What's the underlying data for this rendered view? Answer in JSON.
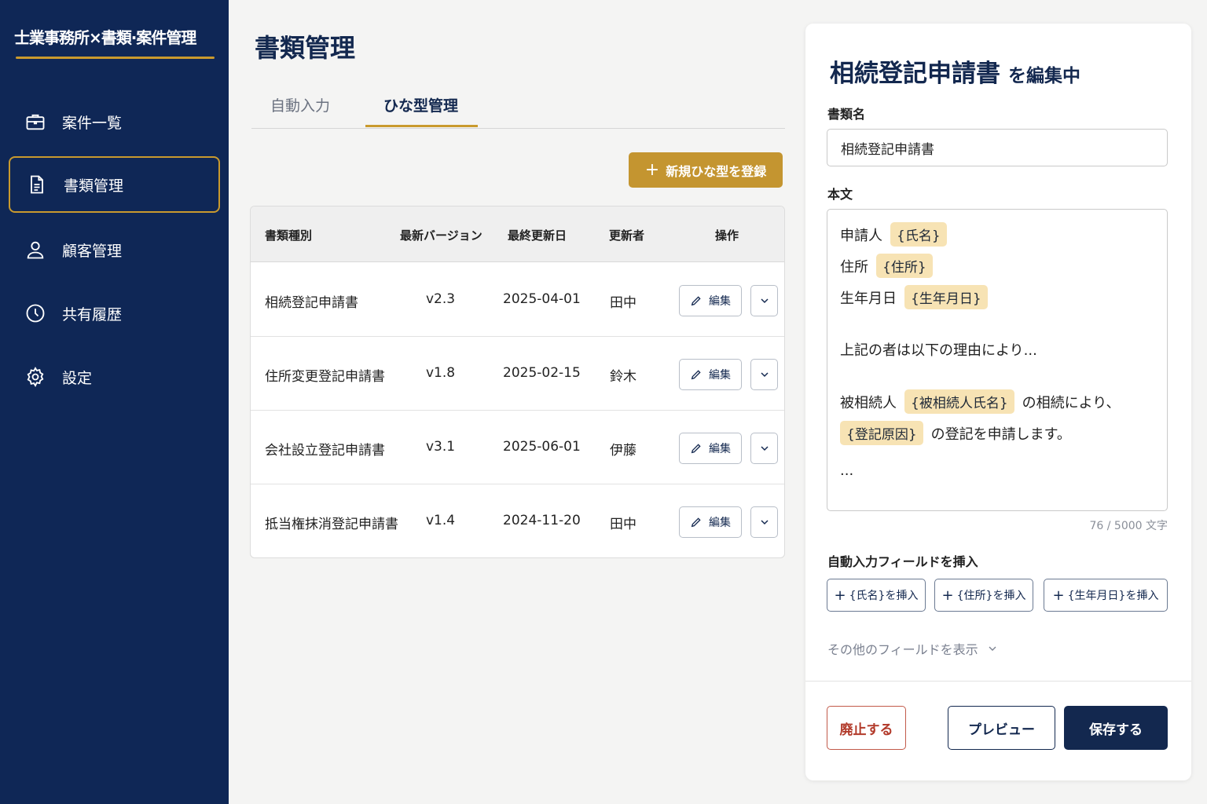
{
  "app": {
    "title": "士業事務所×書類·案件管理"
  },
  "sidebar": {
    "items": [
      {
        "label": "案件一覧",
        "icon": "briefcase-icon"
      },
      {
        "label": "書類管理",
        "icon": "document-icon"
      },
      {
        "label": "顧客管理",
        "icon": "user-icon"
      },
      {
        "label": "共有履歴",
        "icon": "clock-icon"
      },
      {
        "label": "設定",
        "icon": "gear-icon"
      }
    ],
    "active_index": 1
  },
  "main": {
    "title": "書類管理",
    "tabs": [
      {
        "label": "自動入力"
      },
      {
        "label": "ひな型管理"
      }
    ],
    "active_tab": 1,
    "new_template_button": "新規ひな型を登録",
    "table": {
      "headers": [
        "書類種別",
        "最新バージョン",
        "最終更新日",
        "更新者",
        "操作"
      ],
      "rows": [
        {
          "type": "相続登記申請書",
          "version": "v2.3",
          "updated": "2025-04-01",
          "updater": "田中",
          "edit": "編集"
        },
        {
          "type": "住所変更登記申請書",
          "version": "v1.8",
          "updated": "2025-02-15",
          "updater": "鈴木",
          "edit": "編集"
        },
        {
          "type": "会社設立登記申請書",
          "version": "v3.1",
          "updated": "2025-06-01",
          "updater": "伊藤",
          "edit": "編集"
        },
        {
          "type": "抵当権抹消登記申請書",
          "version": "v1.4",
          "updated": "2024-11-20",
          "updater": "田中",
          "edit": "編集"
        }
      ]
    }
  },
  "editor": {
    "doc_name": "相続登記申請書",
    "editing_suffix": "を編集中",
    "name_label": "書類名",
    "name_value": "相続登記申請書",
    "body_label": "本文",
    "body": {
      "l1_text": "申請人",
      "l1_chip": "{氏名}",
      "l2_text": "住所",
      "l2_chip": "{住所}",
      "l3_text": "生年月日",
      "l3_chip": "{生年月日}",
      "l4_text": "上記の者は以下の理由により...",
      "l5_text": "被相続人",
      "l5_chip": "{被相続人氏名}",
      "l5_tail": "の相続により、",
      "l6_chip": "{登記原因}",
      "l6_tail": "の登記を申請します。",
      "l7_text": "..."
    },
    "char_count": "76 / 5000 文字",
    "insert_label": "自動入力フィールドを挿入",
    "insert_buttons": [
      "{氏名}を挿入",
      "{住所}を挿入",
      "{生年月日}を挿入"
    ],
    "more_fields": "その他のフィールドを表示",
    "abolish_button": "廃止する",
    "preview_button": "プレビュー",
    "save_button": "保存する"
  },
  "colors": {
    "navy": "#0f2756",
    "gold": "#c49530",
    "chip": "#f7e3b4",
    "danger": "#b23a2a"
  }
}
